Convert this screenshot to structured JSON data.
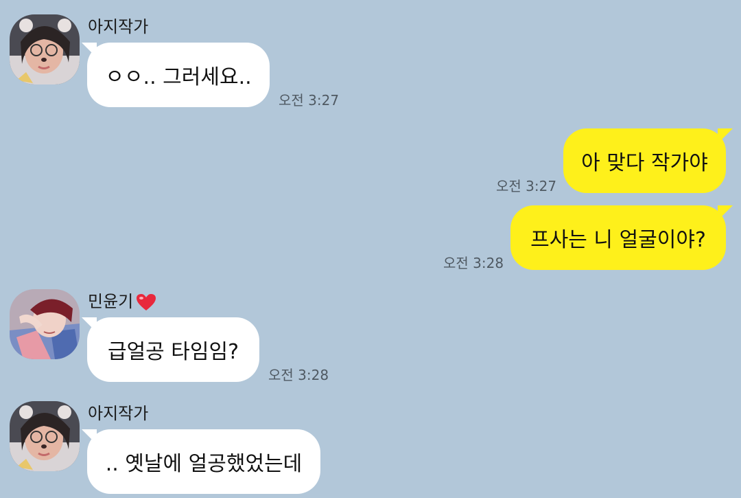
{
  "messages": [
    {
      "sender": "아지작가",
      "text": "ㅇㅇ.. 그러세요..",
      "time": "오전 3:27"
    },
    {
      "text": "아 맞다 작가야",
      "time": "오전 3:27"
    },
    {
      "text": "프사는 니 얼굴이야?",
      "time": "오전 3:28"
    },
    {
      "sender": "민윤기",
      "text": "급얼공 타임임?",
      "time": "오전 3:28"
    },
    {
      "sender": "아지작가",
      "text": ".. 옛날에 얼공했었는데"
    }
  ],
  "colors": {
    "background": "#b2c7d9",
    "incoming_bubble": "#ffffff",
    "outgoing_bubble": "#fef01b",
    "heart": "#e8283c"
  },
  "icons": [
    "heart-icon"
  ]
}
